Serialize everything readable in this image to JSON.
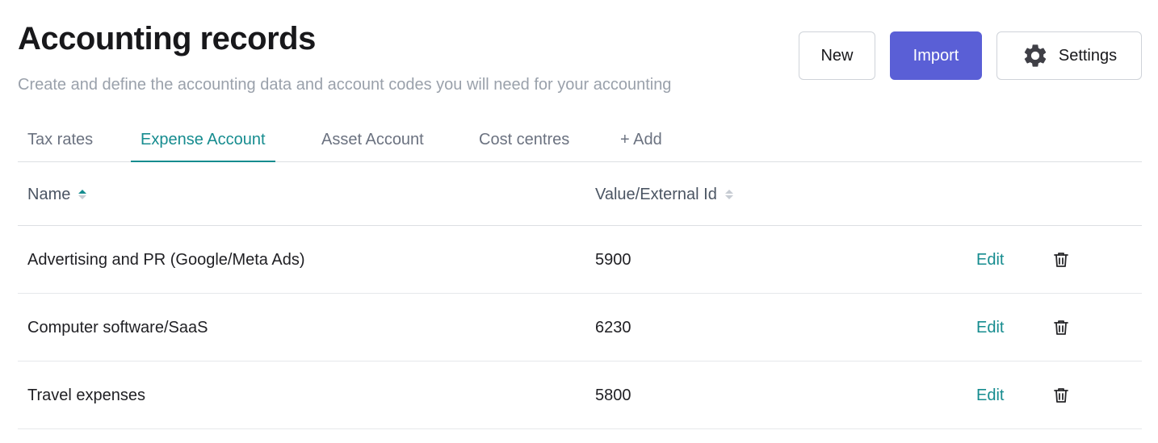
{
  "header": {
    "title": "Accounting records",
    "subtitle": "Create and define the accounting data and account codes you will need for your accounting"
  },
  "actions": {
    "new_label": "New",
    "import_label": "Import",
    "settings_label": "Settings",
    "settings_icon": "gear-icon"
  },
  "tabs": [
    {
      "label": "Tax rates",
      "active": false
    },
    {
      "label": "Expense Account",
      "active": true
    },
    {
      "label": "Asset Account",
      "active": false
    },
    {
      "label": "Cost centres",
      "active": false
    },
    {
      "label": "+ Add",
      "active": false
    }
  ],
  "table": {
    "columns": [
      {
        "label": "Name",
        "sort": "ascending"
      },
      {
        "label": "Value/External Id",
        "sort": "none"
      }
    ],
    "rows": [
      {
        "name": "Advertising and PR (Google/Meta Ads)",
        "value": "5900",
        "edit_label": "Edit",
        "delete_icon": "trash-icon"
      },
      {
        "name": "Computer software/SaaS",
        "value": "6230",
        "edit_label": "Edit",
        "delete_icon": "trash-icon"
      },
      {
        "name": "Travel expenses",
        "value": "5800",
        "edit_label": "Edit",
        "delete_icon": "trash-icon"
      }
    ]
  },
  "colors": {
    "accent": "#168c8f",
    "primary_button": "#5a5fd6",
    "subtitle_text": "#9aa1ab"
  }
}
